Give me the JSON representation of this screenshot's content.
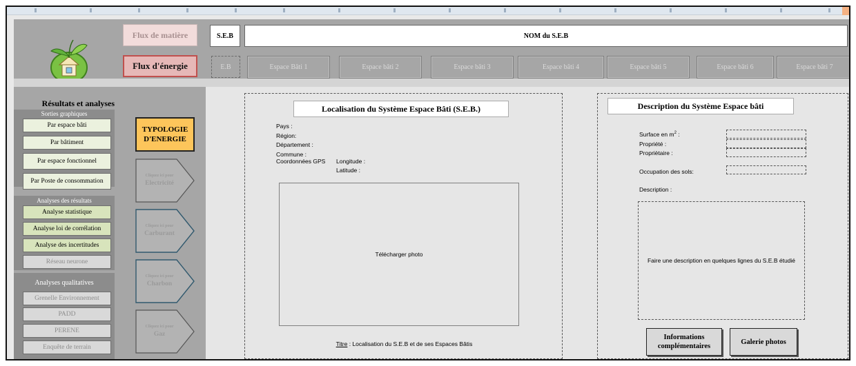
{
  "colors": {
    "green_light": "#ebf1de",
    "green": "#d8e4bc",
    "orange": "#fdc55b",
    "rose": "#e6b8b7"
  },
  "header": {
    "flux_matiere": "Flux de matière",
    "flux_energie": "Flux d'énergie",
    "seb_label": "S.E.B",
    "nom_seb": "NOM du S.E.B",
    "eb_label": "E.B",
    "espaces": [
      "Espace Bâti 1",
      "Espace bâti 2",
      "Espace bâti 3",
      "Espace bâti 4",
      "Espace bâti 5",
      "Espace bâti 6",
      "Espace bâti 7"
    ]
  },
  "sidebar": {
    "title": "Résultats et analyses",
    "sorties_header": "Sorties graphiques",
    "sorties": [
      "Par espace bâti",
      "Par bâtiment",
      "Par espace fonctionnel",
      "Par Poste de consommation"
    ],
    "analyses_header": "Analyses des résultats",
    "analyses": [
      "Analyse statistique",
      "Analyse loi de corrélation",
      "Analyse des incertitudes",
      "Réseau neurone"
    ],
    "qualitatives_header": "Analyses qualitatives",
    "qualitatives": [
      "Grenelle Environnement",
      "PADD",
      "PERENE",
      "Enquête de terrain"
    ]
  },
  "energy": {
    "typologie": "TYPOLOGIE D'ENERGIE",
    "click_hint": "Cliquez ici pour",
    "types": [
      "Electricité",
      "Carburant",
      "Charbon",
      "Gaz"
    ]
  },
  "localisation": {
    "title": "Localisation du Système Espace Bâti (S.E.B.)",
    "pays": "Pays :",
    "region": "Région:",
    "departement": "Département :",
    "commune": "Commune :",
    "coordonnees": "Coordonnées GPS",
    "longitude": "Longitude :",
    "latitude": "Latitude :",
    "photo": "Télécharger photo",
    "caption_label": "Titre",
    "caption_text": " : Localisation du S.E.B et de ses Espaces Bâtis"
  },
  "description": {
    "title": "Description du Système  Espace bâti",
    "surface": "Surface en m",
    "surface_exp": "2",
    "surface_tail": " :",
    "propriete": "Propriété :",
    "proprietaire": "Propriètaire :",
    "occupation": "Occupation des sols:",
    "description": "Description :",
    "placeholder": "Faire une description en quelques lignes du S.E.B étudié",
    "btn_info": "Informations complémentaires",
    "btn_galerie": "Galerie photos"
  }
}
